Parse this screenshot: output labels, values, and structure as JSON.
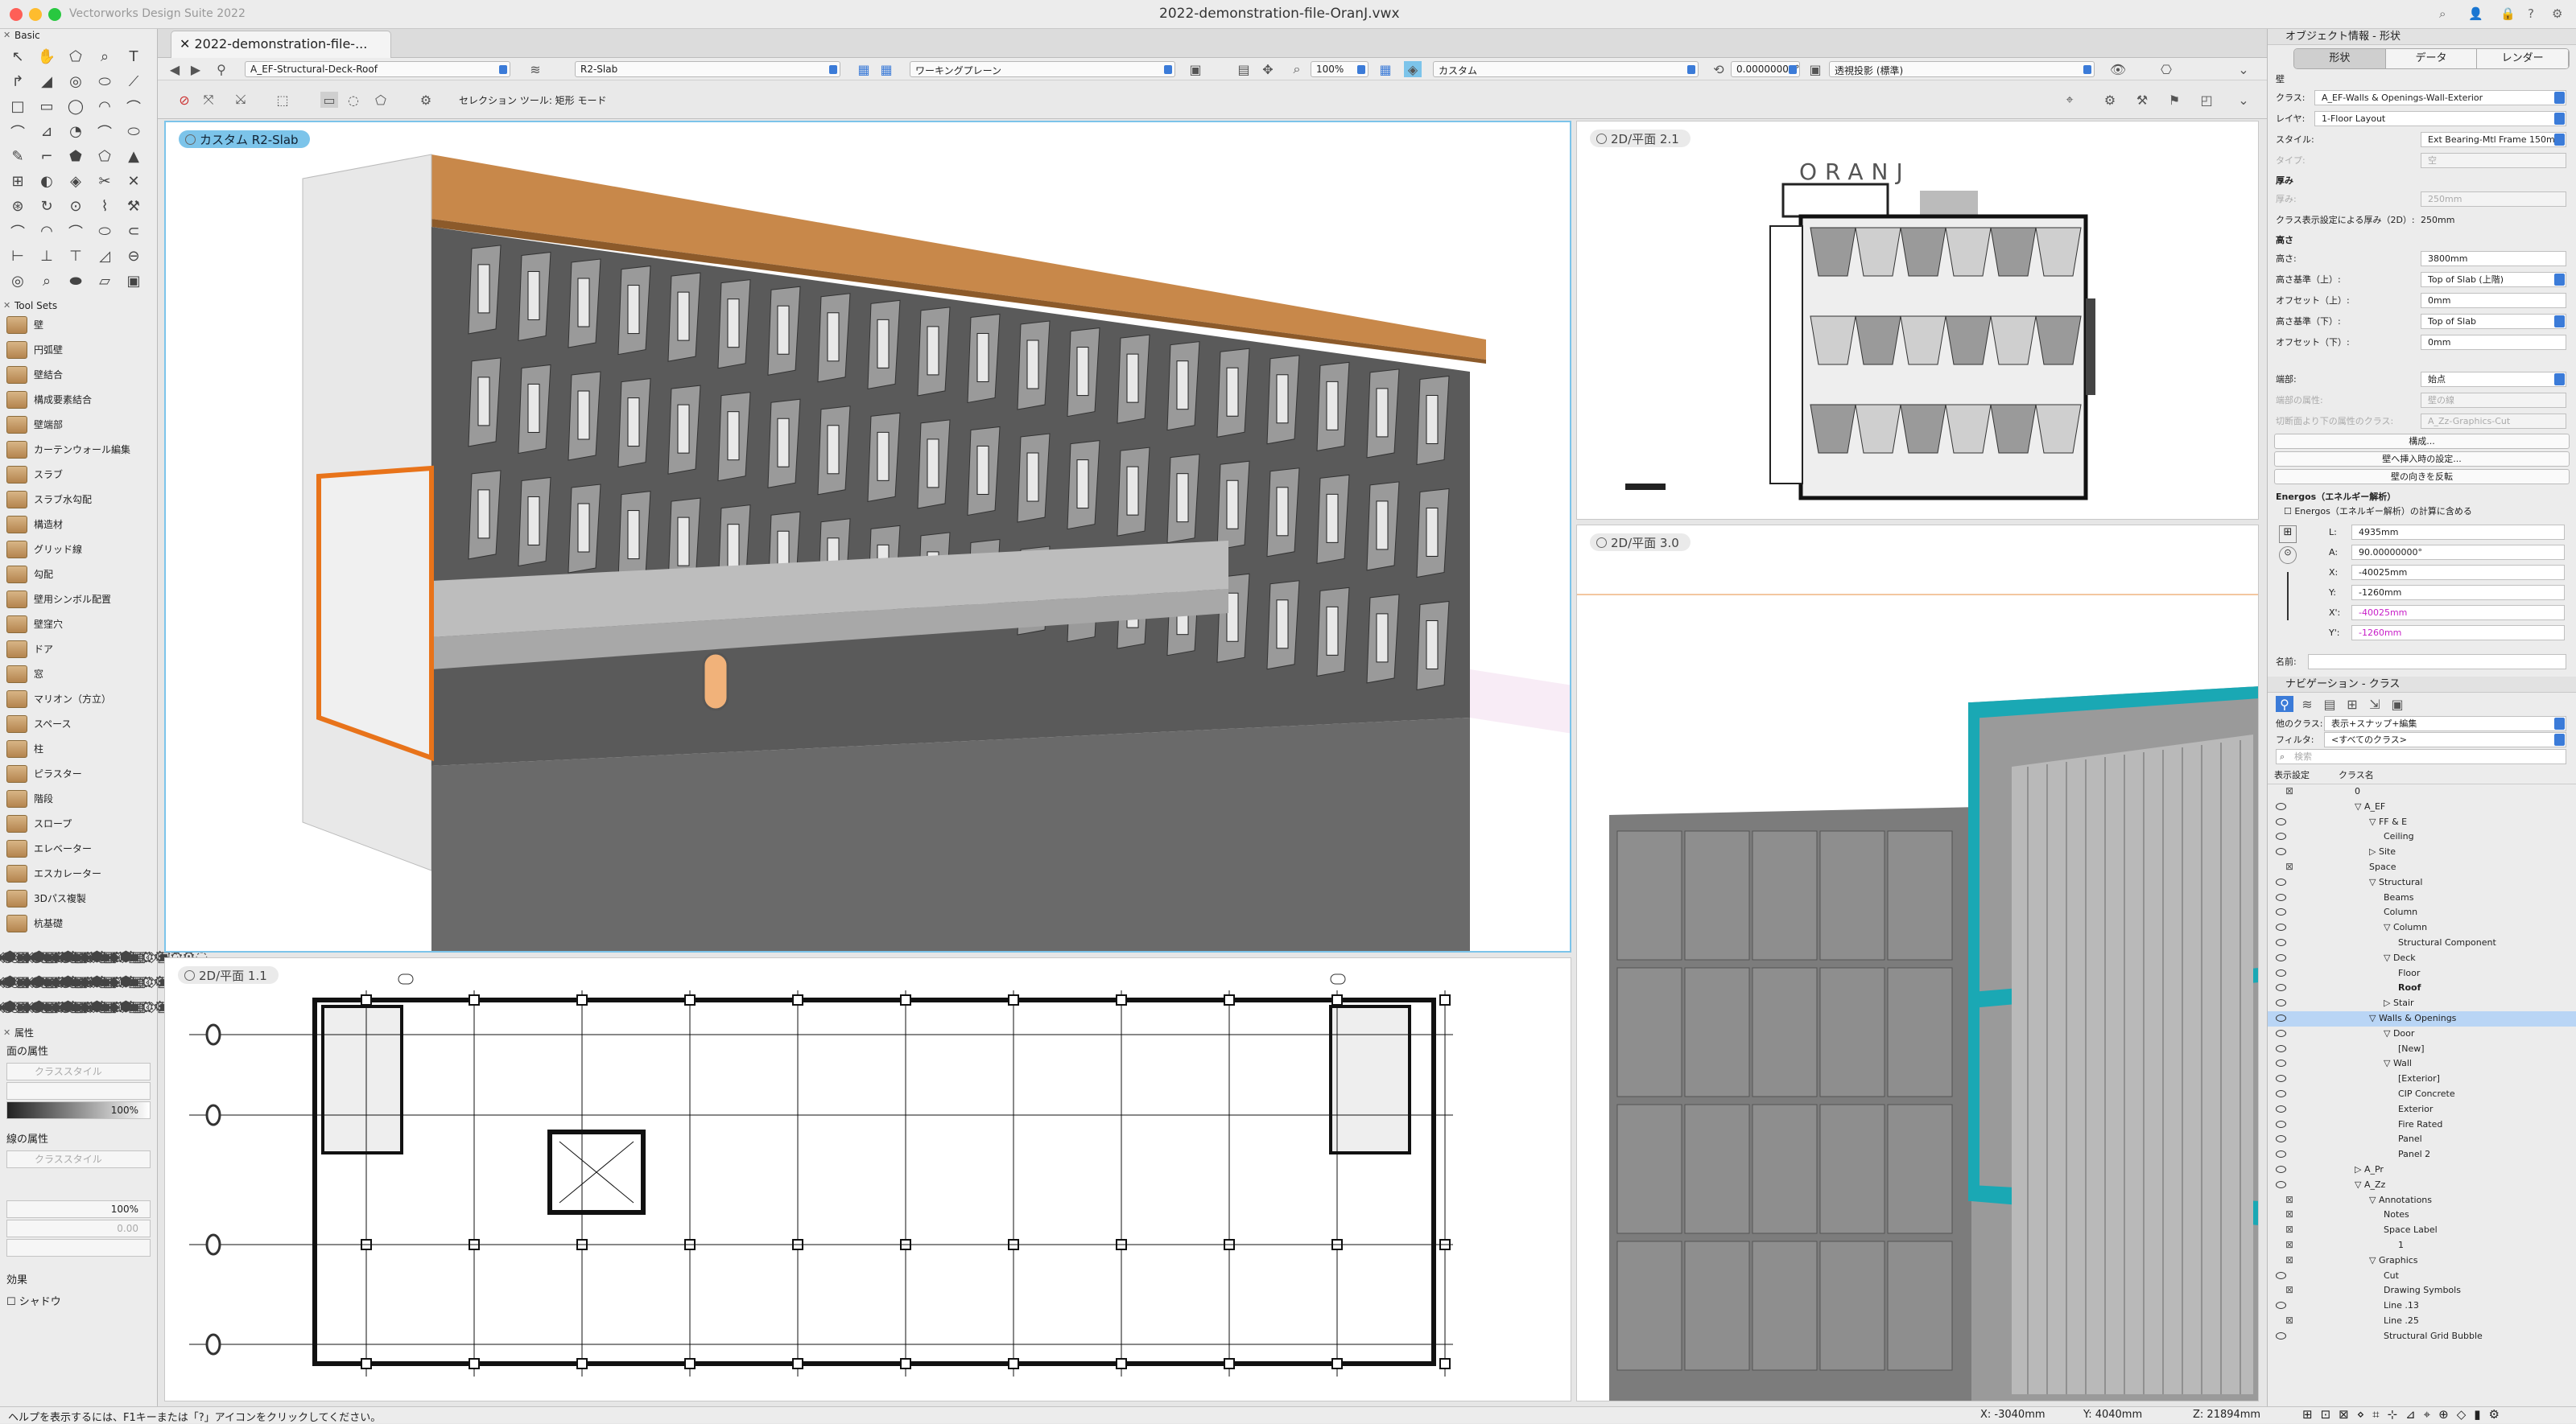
{
  "app": {
    "name": "Vectorworks Design Suite 2022",
    "window_title": "2022-demonstration-file-OranJ.vwx",
    "doc_tab": "2022-demonstration-file-..."
  },
  "toolbar": {
    "class": "A_EF-Structural-Deck-Roof",
    "layer": "R2-Slab",
    "plane": "ワーキングプレーン",
    "zoom": "100%",
    "view": "カスタム",
    "angle": "0.00000000°",
    "projection": "透視投影 (標準)",
    "mode_hint": "セレクション ツール: 矩形 モード"
  },
  "left": {
    "basic_title": "Basic",
    "toolsets_title": "Tool Sets",
    "toolsets": [
      "壁",
      "円弧壁",
      "壁結合",
      "構成要素結合",
      "壁端部",
      "カーテンウォール編集",
      "スラブ",
      "スラブ水勾配",
      "構造材",
      "グリッド線",
      "勾配",
      "壁用シンボル配置",
      "壁窪穴",
      "ドア",
      "窓",
      "マリオン（方立）",
      "スペース",
      "柱",
      "ピラスター",
      "階段",
      "スロープ",
      "エレベーター",
      "エスカレーター",
      "3Dパス複製",
      "杭基礎"
    ],
    "attrs_title": "属性",
    "fill_label": "面の属性",
    "class_style": "クラススタイル",
    "pct": "100%",
    "line_label": "線の属性",
    "line_pct": "100%",
    "zero": "0.00",
    "effects": "効果",
    "shadow": "シャドウ"
  },
  "viewports": {
    "main": "カスタム  R2-Slab",
    "top_right": "2D/平面  2.1",
    "bottom_left": "2D/平面  1.1",
    "bottom_right": "2D/平面  3.0",
    "oranj_text": "ORANJ"
  },
  "obj": {
    "title": "オブジェクト情報 - 形状",
    "tabs": [
      "形状",
      "データ",
      "レンダー"
    ],
    "kind": "壁",
    "class_lbl": "クラス:",
    "class_val": "A_EF-Walls & Openings-Wall-Exterior",
    "layer_lbl": "レイヤ:",
    "layer_val": "1-Floor Layout",
    "style_lbl": "スタイル:",
    "style_val": "Ext Bearing-Mtl Frame 150mm",
    "type_lbl": "タイプ:",
    "type_val": "空",
    "thick_sect": "厚み",
    "thick_lbl": "厚み:",
    "thick_val": "250mm",
    "class_thick_lbl": "クラス表示設定による厚み（2D）:",
    "class_thick_val": "250mm",
    "height_sect": "高さ",
    "h_lbl": "高さ:",
    "h_val": "3800mm",
    "top_lbl": "高さ基準（上）:",
    "top_val": "Top of Slab (上階)",
    "topoff_lbl": "オフセット（上）:",
    "topoff_val": "0mm",
    "bot_lbl": "高さ基準（下）:",
    "bot_val": "Top of Slab",
    "botoff_lbl": "オフセット（下）:",
    "botoff_val": "0mm",
    "cap_lbl": "端部:",
    "cap_val": "始点",
    "cap2_lbl": "端部の属性:",
    "cap2_val": "壁の線",
    "cut_lbl": "切断面より下の属性のクラス:",
    "cut_val": "A_Zz-Graphics-Cut",
    "btn1": "構成...",
    "btn2": "壁へ挿入時の設定...",
    "btn3": "壁の向きを反転",
    "energos_sect": "Energos（エネルギー解析）",
    "energos_chk": "Energos（エネルギー解析）の計算に含める",
    "L_lbl": "L:",
    "L": "4935mm",
    "A_lbl": "A:",
    "A": "90.00000000°",
    "X_lbl": "X:",
    "X": "-40025mm",
    "Y_lbl": "Y:",
    "Y": "-1260mm",
    "X2_lbl": "X':",
    "X2": "-40025mm",
    "Y2_lbl": "Y':",
    "Y2": "-1260mm",
    "name_lbl": "名前:"
  },
  "nav": {
    "title": "ナビゲーション - クラス",
    "other_lbl": "他のクラス:",
    "other_val": "表示+スナップ+編集",
    "filter_lbl": "フィルタ:",
    "filter_val": "<すべてのクラス>",
    "search_ph": "検索",
    "col1": "表示設定",
    "col2": "クラス名",
    "rows": [
      {
        "n": "0",
        "d": 0,
        "t": "x"
      },
      {
        "n": "A_EF",
        "d": 0,
        "t": "e",
        "a": "▽"
      },
      {
        "n": "FF & E",
        "d": 1,
        "t": "e",
        "a": "▽"
      },
      {
        "n": "Ceiling",
        "d": 2,
        "t": "e"
      },
      {
        "n": "Site",
        "d": 1,
        "t": "e",
        "a": "▷"
      },
      {
        "n": "Space",
        "d": 1,
        "t": "x"
      },
      {
        "n": "Structural",
        "d": 1,
        "t": "e",
        "a": "▽"
      },
      {
        "n": "Beams",
        "d": 2,
        "t": "e"
      },
      {
        "n": "Column",
        "d": 2,
        "t": "e"
      },
      {
        "n": "Column",
        "d": 2,
        "t": "e",
        "a": "▽"
      },
      {
        "n": "Structural Component",
        "d": 3,
        "t": "e"
      },
      {
        "n": "Deck",
        "d": 2,
        "t": "e",
        "a": "▽"
      },
      {
        "n": "Floor",
        "d": 3,
        "t": "e"
      },
      {
        "n": "Roof",
        "d": 3,
        "t": "e",
        "b": true
      },
      {
        "n": "Stair",
        "d": 2,
        "t": "e",
        "a": "▷"
      },
      {
        "n": "Walls & Openings",
        "d": 1,
        "t": "e",
        "a": "▽",
        "s": true
      },
      {
        "n": "Door",
        "d": 2,
        "t": "e",
        "a": "▽"
      },
      {
        "n": "[New]",
        "d": 3,
        "t": "e"
      },
      {
        "n": "Wall",
        "d": 2,
        "t": "e",
        "a": "▽"
      },
      {
        "n": "[Exterior]",
        "d": 3,
        "t": "e"
      },
      {
        "n": "CIP Concrete",
        "d": 3,
        "t": "e"
      },
      {
        "n": "Exterior",
        "d": 3,
        "t": "e"
      },
      {
        "n": "Fire Rated",
        "d": 3,
        "t": "e"
      },
      {
        "n": "Panel",
        "d": 3,
        "t": "e"
      },
      {
        "n": "Panel 2",
        "d": 3,
        "t": "e"
      },
      {
        "n": "A_Pr",
        "d": 0,
        "t": "e",
        "a": "▷"
      },
      {
        "n": "A_Zz",
        "d": 0,
        "t": "e",
        "a": "▽"
      },
      {
        "n": "Annotations",
        "d": 1,
        "t": "x",
        "a": "▽"
      },
      {
        "n": "Notes",
        "d": 2,
        "t": "x"
      },
      {
        "n": "Space Label",
        "d": 2,
        "t": "x"
      },
      {
        "n": "1",
        "d": 3,
        "t": "x"
      },
      {
        "n": "Graphics",
        "d": 1,
        "t": "x",
        "a": "▽"
      },
      {
        "n": "Cut",
        "d": 2,
        "t": "e"
      },
      {
        "n": "Drawing Symbols",
        "d": 2,
        "t": "x"
      },
      {
        "n": "Line .13",
        "d": 2,
        "t": "e"
      },
      {
        "n": "Line .25",
        "d": 2,
        "t": "x"
      },
      {
        "n": "Structural Grid Bubble",
        "d": 2,
        "t": "e"
      }
    ]
  },
  "status": {
    "help": "ヘルプを表示するには、F1キーまたは「?」アイコンをクリックしてください。",
    "x": "X: -3040mm",
    "y": "Y: 4040mm",
    "z": "Z: 21894mm"
  },
  "colors": {
    "accent": "#3b7bd8",
    "selection": "#e8731a",
    "teal": "#1aa8b4",
    "wood": "#c8884a"
  }
}
